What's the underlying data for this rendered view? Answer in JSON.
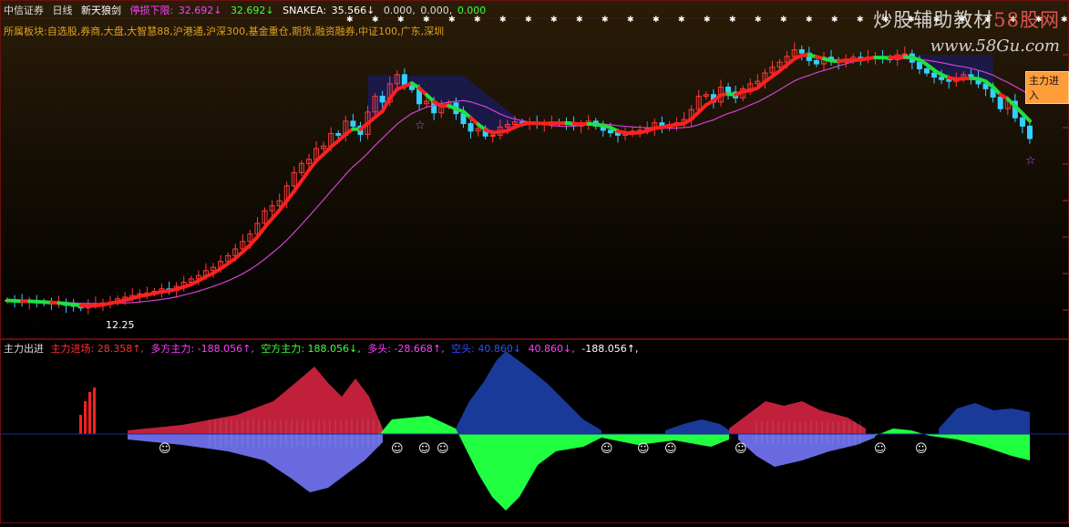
{
  "header": {
    "broker": "中信证券",
    "period": "日线",
    "indicator": "新天狼剑",
    "limit_label": "停损下限:",
    "limit_value": "32.692↓",
    "value2": "32.692↓",
    "snake_label": "SNAKEA:",
    "snake_value": "35.566↓",
    "z1": "0.000,",
    "z2": "0.000,",
    "z3": "0.000"
  },
  "sectors": "所属板块:自选股,券商,大盘,大智慧88,沪港通,沪深300,基金重仓,期货,融资融券,中证100,广东,深圳",
  "watermark": {
    "line1a": "炒股辅助教材",
    "line1b": "58股网",
    "line2": "www.58Gu.com"
  },
  "badge": "主力进入",
  "low_label": "12.25",
  "lower": {
    "title": "主力出进",
    "main_label": "主力进场:",
    "main_value": "28.358↑,",
    "long_label": "多方主力:",
    "long_value": "-188.056↑,",
    "short_label": "空方主力:",
    "short_value": "188.056↓,",
    "bull_label": "多头:",
    "bull_value": "-28.668↑,",
    "bear_label": "空头:",
    "bear_value": "40.860↓",
    "extra1": "40.860↓,",
    "extra2": "-188.056↑,"
  },
  "chart_data": [
    {
      "type": "candlestick",
      "title": "",
      "series": [
        {
          "name": "",
          "x": [
            1,
            2,
            3,
            4,
            5,
            6,
            7,
            8,
            9,
            10,
            11,
            12,
            13,
            14,
            15,
            16,
            17,
            18,
            19,
            20,
            21,
            22,
            23,
            24,
            25,
            26,
            27,
            28,
            29,
            30,
            31,
            32,
            33,
            34,
            35,
            36,
            37,
            38,
            39,
            40,
            41,
            42,
            43,
            44,
            45,
            46,
            47,
            48,
            49,
            50,
            51,
            52,
            53,
            54,
            55,
            56,
            57,
            58,
            59,
            60,
            61,
            62,
            63,
            64,
            65,
            66,
            67,
            68,
            69,
            70,
            71,
            72,
            73,
            74,
            75,
            76,
            77,
            78,
            79,
            80,
            81,
            82,
            83,
            84,
            85,
            86,
            87,
            88,
            89,
            90,
            91,
            92,
            93,
            94,
            95,
            96,
            97,
            98,
            99,
            100,
            101,
            102,
            103,
            104,
            105,
            106,
            107,
            108,
            109,
            110,
            111,
            112,
            113,
            114,
            115,
            116,
            117,
            118,
            119,
            120,
            121,
            122,
            123,
            124,
            125,
            126,
            127,
            128,
            129,
            130,
            131,
            132,
            133,
            134,
            135,
            136,
            137,
            138,
            139,
            140
          ],
          "close": [
            13.2,
            13.1,
            13.0,
            13.1,
            13.0,
            12.9,
            12.8,
            12.9,
            12.6,
            12.5,
            12.3,
            12.7,
            12.8,
            12.9,
            13.0,
            13.4,
            13.6,
            13.8,
            14.0,
            14.1,
            14.3,
            14.6,
            14.4,
            14.9,
            15.4,
            15.8,
            16.2,
            16.8,
            17.2,
            17.9,
            18.6,
            19.4,
            20.3,
            21.2,
            22.5,
            24.0,
            24.6,
            25.2,
            27.0,
            28.6,
            29.7,
            30.2,
            31.5,
            31.8,
            33.3,
            33.1,
            34.8,
            34.2,
            33.2,
            35.9,
            37.8,
            37.1,
            39.3,
            40.4,
            39.2,
            38.6,
            36.9,
            37.2,
            35.8,
            36.6,
            37.0,
            35.7,
            34.5,
            33.6,
            33.9,
            33.0,
            33.1,
            34.1,
            34.4,
            34.7,
            34.5,
            34.6,
            34.4,
            34.5,
            34.7,
            34.6,
            34.5,
            34.2,
            34.4,
            34.8,
            34.2,
            33.7,
            33.4,
            33.1,
            33.3,
            33.6,
            33.7,
            33.9,
            34.6,
            34.0,
            34.4,
            34.6,
            35.0,
            36.2,
            37.8,
            38.0,
            37.1,
            38.9,
            38.3,
            37.6,
            38.7,
            39.3,
            39.6,
            40.6,
            41.3,
            41.9,
            42.6,
            43.4,
            43.0,
            42.1,
            41.7,
            42.5,
            42.0,
            41.9,
            42.1,
            42.5,
            42.3,
            42.5,
            42.6,
            42.4,
            42.2,
            42.8,
            42.9,
            41.9,
            41.1,
            40.6,
            40.1,
            39.8,
            39.6,
            39.9,
            40.4,
            40.0,
            39.3,
            38.7,
            37.7,
            36.3,
            37.2,
            35.2,
            34.2,
            32.7
          ]
        },
        {
          "name": "SNAKEA",
          "values": [
            35.566
          ]
        }
      ]
    },
    {
      "type": "area",
      "title": "主力出进",
      "series": [
        {
          "name": "主力进场",
          "last": 28.358
        },
        {
          "name": "多方主力",
          "last": -188.056
        },
        {
          "name": "空方主力",
          "last": 188.056
        },
        {
          "name": "多头",
          "last": -28.668
        },
        {
          "name": "空头",
          "last": 40.86
        }
      ]
    }
  ]
}
